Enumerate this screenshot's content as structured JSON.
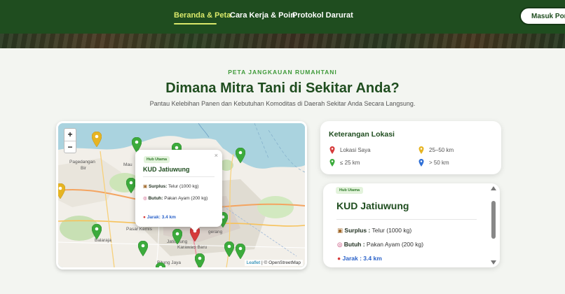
{
  "nav": {
    "links": [
      "Beranda & Peta",
      "Cara Kerja & Poin",
      "Protokol Darurat"
    ],
    "active_index": 0,
    "portal_button": "Masuk Portal"
  },
  "section": {
    "kicker": "PETA JANGKAUAN RUMAHTANI",
    "title": "Dimana Mitra Tani di Sekitar Anda?",
    "subtitle": "Pantau Kelebihan Panen dan Kebutuhan Komoditas di Daerah Sekitar Anda Secara Langsung."
  },
  "map": {
    "zoom_in": "+",
    "zoom_out": "−",
    "place_labels": [
      "Pagedangan",
      "Bir",
      "Mau",
      "Balaraja",
      "Pasar Kemis",
      "Jatiuwung",
      "Karawaci Baru",
      "Bitung Jaya",
      "Tangerang",
      "gerang"
    ],
    "attribution": {
      "leaflet": "Leaflet",
      "separator": "|",
      "osm": "© OpenStreetMap"
    },
    "popup": {
      "badge": "Hub Utama",
      "title": "KUD Jatiuwung",
      "close": "×",
      "surplus_label": "Surplus:",
      "surplus_value": "Telur (1000 kg)",
      "butuh_label": "Butuh:",
      "butuh_value": "Pakan Ayam (200 kg)",
      "distance": "Jarak: 3.4 km"
    }
  },
  "legend": {
    "title": "Keterangan Lokasi",
    "items": [
      {
        "label": "Lokasi Saya",
        "color": "#d63b3b"
      },
      {
        "label": "25–50 km",
        "color": "#e6b422"
      },
      {
        "label": "≤ 25 km",
        "color": "#3cab3c"
      },
      {
        "label": "> 50 km",
        "color": "#2f6fd6"
      }
    ]
  },
  "detail": {
    "badge": "Hub Utama",
    "title": "KUD Jatiuwung",
    "surplus_label": "Surplus :",
    "surplus_value": "Telur (1000 kg)",
    "butuh_label": "Butuh :",
    "butuh_value": "Pakan Ayam (200 kg)",
    "distance": "Jarak : 3.4 km"
  },
  "colors": {
    "nav_bg": "#1f4d1f",
    "active_link": "#d9e86a",
    "heading": "#1f4d1f",
    "accent_green": "#3cab3c",
    "distance_blue": "#2a62c9"
  }
}
